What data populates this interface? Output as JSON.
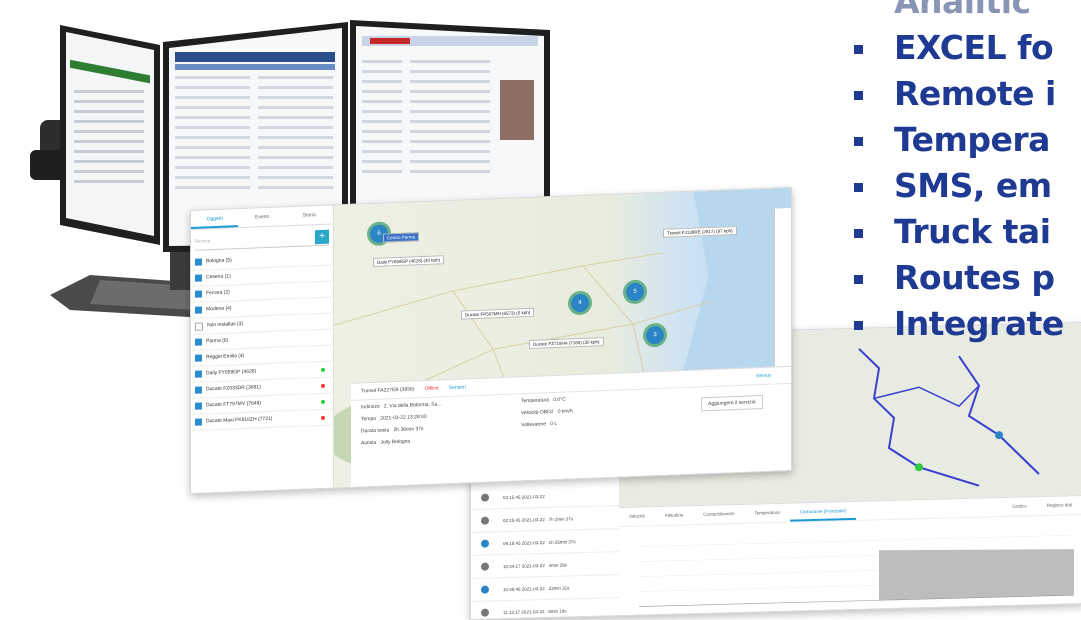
{
  "bullets": [
    {
      "text": "Analitic"
    },
    {
      "text": "EXCEL fo"
    },
    {
      "text": "Remote i"
    },
    {
      "text": "Tempera"
    },
    {
      "text": "SMS, em"
    },
    {
      "text": "Truck tai"
    },
    {
      "text": "Routes p"
    },
    {
      "text": "Integrate"
    }
  ],
  "map_panel": {
    "tabs": [
      "Oggetti",
      "Eventi",
      "Storia"
    ],
    "search_placeholder": "Ricerca",
    "groups": [
      {
        "label": "Bologna (5)"
      },
      {
        "label": "Cesena (1)"
      },
      {
        "label": "Ferrara (2)"
      },
      {
        "label": "Modena (4)"
      },
      {
        "label": "Non installati (3)"
      },
      {
        "label": "Parma (6)"
      },
      {
        "label": "Reggio Emilia (4)"
      }
    ],
    "vehicles": [
      {
        "label": "Daily FY658GP (4628)",
        "status_color": "#2ecc40"
      },
      {
        "label": "Ducato FZ033DR (3681)",
        "status_color": "#ff3b30"
      },
      {
        "label": "Ducato FT797MV (7648)",
        "status_color": "#2ecc40"
      },
      {
        "label": "Ducato Maxi FK916ZH (7721)",
        "status_color": "#ff3b30"
      }
    ]
  },
  "map_labels": [
    {
      "text": "Centro Parma"
    },
    {
      "text": "Daily FY658GP (4628) (40 kph)"
    },
    {
      "text": "Transit FJ138RE (2817) (97 kph)"
    },
    {
      "text": "Ducato FP567MN (6573) (0 kph)"
    },
    {
      "text": "Ducato FZ718HA (7180) (30 kph)"
    }
  ],
  "bottom_panel": {
    "title": "Transit FA227EB (3656)",
    "status": "Offline",
    "sensors_title": "Sensori",
    "services_title": "Servizi",
    "add_service": "Aggiungere il servizio",
    "rows": [
      {
        "k": "Indirizzo",
        "v": "2, Via della Bolorma, Sa..."
      },
      {
        "k": "Tempo",
        "v": "2021-03-22 13:28:00"
      },
      {
        "k": "Durata sosta",
        "v": "2h 36min 37s"
      },
      {
        "k": "Autista",
        "v": "Jolly Bologna"
      }
    ],
    "sensors": [
      {
        "k": "Temperatura",
        "v": "0.0°C"
      },
      {
        "k": "Velocità OBD2",
        "v": "0 km/h"
      },
      {
        "k": "Sollevatore",
        "v": "0 L"
      }
    ]
  },
  "history": {
    "rows": [
      {
        "time": "02:15:45 2021-03-22"
      },
      {
        "time": "02:15:45 2021-03-22",
        "dur": "7h 2min 37s"
      },
      {
        "time": "09:18:45 2021-03-22",
        "dur": "1h 25min 37s"
      },
      {
        "time": "10:44:17 2021-03-22",
        "dur": "4min 29s"
      },
      {
        "time": "10:48:46 2021-03-22",
        "dur": "23min 31s"
      },
      {
        "time": "11:12:17 2021-03-22",
        "dur": "8min 19s"
      }
    ],
    "chart_tabs": [
      "Velocità",
      "Altitudine",
      "Contachilometri",
      "Temperatura",
      "Carburante (Principale)"
    ],
    "chart_actions": [
      "Grafico",
      "Registro dati"
    ]
  }
}
